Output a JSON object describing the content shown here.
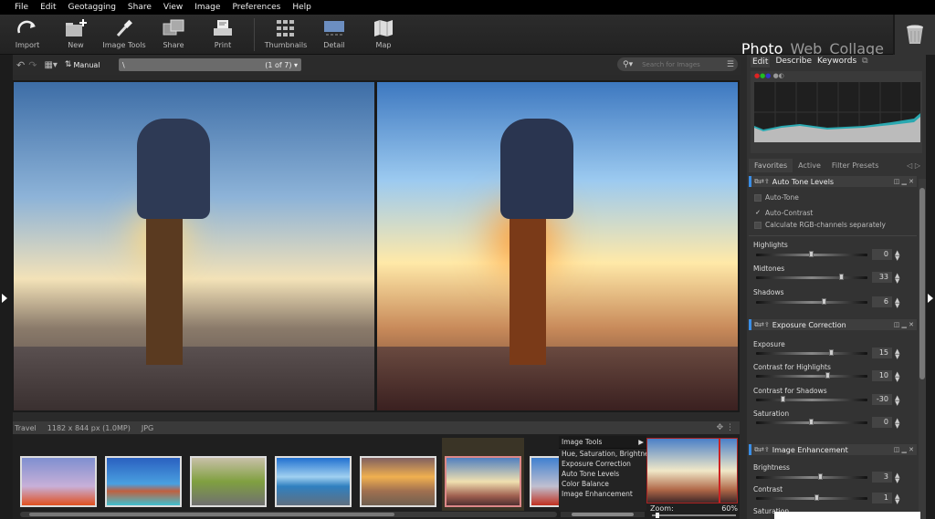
{
  "menu": [
    "File",
    "Edit",
    "Geotagging",
    "Share",
    "View",
    "Image",
    "Preferences",
    "Help"
  ],
  "toolbar": {
    "buttons": [
      {
        "label": "Import",
        "icon": "import-arrow-icon"
      },
      {
        "label": "New",
        "icon": "new-folder-icon"
      },
      {
        "label": "Image Tools",
        "icon": "eyedropper-icon"
      },
      {
        "label": "Share",
        "icon": "share-photos-icon"
      },
      {
        "label": "Print",
        "icon": "printer-icon"
      },
      {
        "label": "Thumbnails",
        "icon": "thumbnails-grid-icon"
      },
      {
        "label": "Detail",
        "icon": "detail-view-icon"
      },
      {
        "label": "Map",
        "icon": "map-icon"
      }
    ],
    "modes": {
      "photo": "Photo",
      "web": "Web",
      "collage": "Collage",
      "active": "Photo"
    }
  },
  "subbar": {
    "sort_label": "Manual",
    "path": "\\",
    "path_count": "(1 of 7)",
    "search_placeholder": "Search for Images"
  },
  "status": {
    "album": "Travel",
    "dimensions": "1182 x 844 px",
    "megapixels": "(1.0MP)",
    "format": "JPG"
  },
  "filmstrip": {
    "thumbnails": [
      "Woman in red dress Paris",
      "Brooklyn bridge skyline",
      "Cyclist on road",
      "Lake pier sunrise",
      "Boat on beach sunset",
      "Hiker sunrise (selected)",
      "Lifeguard tower"
    ],
    "selected_index": 5
  },
  "image_tools_popup": {
    "title": "Image Tools",
    "items": [
      "Hue, Saturation, Brightness",
      "Exposure Correction",
      "Auto Tone Levels",
      "Color Balance",
      "Image Enhancement"
    ]
  },
  "preview": {
    "zoom_label": "Zoom:",
    "zoom_value": "60%"
  },
  "right_panel": {
    "tabs": [
      "Edit",
      "Describe",
      "Keywords"
    ],
    "active_tab": "Edit",
    "filter_tabs": [
      "Favorites",
      "Active",
      "Filter Presets"
    ],
    "active_filter_tab": "Favorites",
    "sections": [
      {
        "title": "Auto Tone Levels",
        "checkboxes": [
          {
            "label": "Auto-Tone",
            "checked": false
          },
          {
            "label": "Auto-Contrast",
            "checked": true
          },
          {
            "label": "Calculate RGB-channels separately",
            "checked": false
          }
        ],
        "sliders": [
          {
            "label": "Highlights",
            "value": "0"
          },
          {
            "label": "Midtones",
            "value": "33"
          },
          {
            "label": "Shadows",
            "value": "6"
          }
        ]
      },
      {
        "title": "Exposure Correction",
        "sliders": [
          {
            "label": "Exposure",
            "value": "15"
          },
          {
            "label": "Contrast for Highlights",
            "value": "10"
          },
          {
            "label": "Contrast for Shadows",
            "value": "-30"
          },
          {
            "label": "Saturation",
            "value": "0"
          }
        ]
      },
      {
        "title": "Image Enhancement",
        "sliders": [
          {
            "label": "Brightness",
            "value": "3"
          },
          {
            "label": "Contrast",
            "value": "1"
          },
          {
            "label": "Saturation",
            "value": ""
          }
        ]
      }
    ]
  },
  "colors": {
    "accent": "#3a8ee6",
    "selection": "#aa2222"
  }
}
